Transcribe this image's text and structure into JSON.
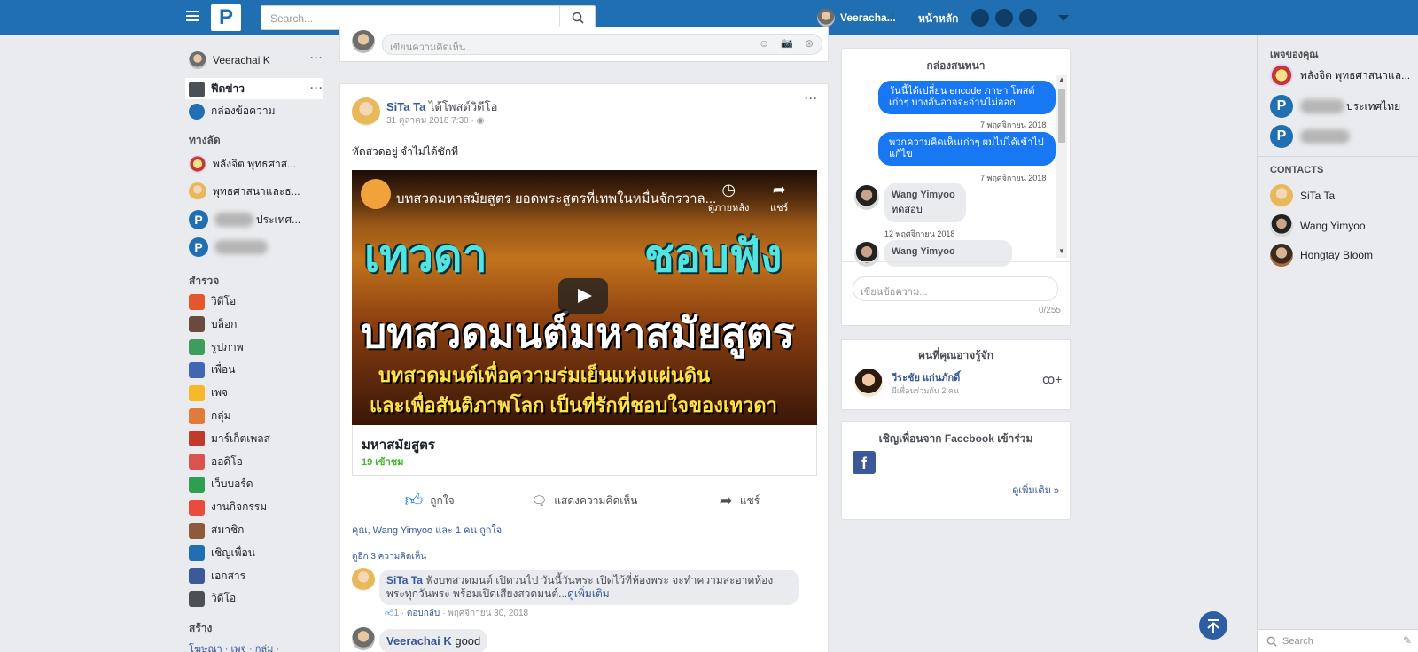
{
  "header": {
    "search_placeholder": "Search...",
    "user_name": "Veeracha...",
    "home_label": "หน้าหลัก"
  },
  "left_sidebar": {
    "profile_name": "Veerachai K",
    "news_feed": "ฟีดข่าว",
    "inbox": "กล่องข้อความ",
    "shortcuts_title": "ทางลัด",
    "shortcuts": [
      "พลังจิต พุทธศาส...",
      "พุทธศาสนาและธ...",
      "ประเทศ..."
    ],
    "explore_title": "สำรวจ",
    "explore": [
      {
        "label": "วิดีโอ",
        "icon": "video-clapper-icon",
        "color": "#e4572e"
      },
      {
        "label": "บล็อก",
        "icon": "blog-icon",
        "color": "#6a4a3c"
      },
      {
        "label": "รูปภาพ",
        "icon": "photo-icon",
        "color": "#3c9d5d"
      },
      {
        "label": "เพื่อน",
        "icon": "friends-icon",
        "color": "#4267b2"
      },
      {
        "label": "เพจ",
        "icon": "page-flag-icon",
        "color": "#f7b928"
      },
      {
        "label": "กลุ่ม",
        "icon": "group-icon",
        "color": "#e07b39"
      },
      {
        "label": "มาร์เก็ตเพลส",
        "icon": "marketplace-icon",
        "color": "#c0392b"
      },
      {
        "label": "ออดิโอ",
        "icon": "headphones-icon",
        "color": "#d9534f"
      },
      {
        "label": "เว็บบอร์ด",
        "icon": "forum-icon",
        "color": "#2e9e4f"
      },
      {
        "label": "งานกิจกรรม",
        "icon": "event-calendar-icon",
        "color": "#e74c3c"
      },
      {
        "label": "สมาชิก",
        "icon": "members-icon",
        "color": "#8e5a3c"
      },
      {
        "label": "เชิญเพื่อน",
        "icon": "invite-icon",
        "color": "#1f6fb2"
      },
      {
        "label": "เอกสาร",
        "icon": "document-icon",
        "color": "#3b5998"
      },
      {
        "label": "วิดีโอ",
        "icon": "video-camera-icon",
        "color": "#4b4f56"
      }
    ],
    "create_title": "สร้าง",
    "create_links": "โฆษณา · เพจ · กลุ่ม ·"
  },
  "feed": {
    "comment_placeholder_top": "เขียนความคิดเห็น...",
    "post": {
      "author": "SiTa Ta",
      "action": "ได้โพสต์วิดีโอ",
      "time": "31 ตุลาคม 2018 7:30",
      "text": "หัดสวดอยู่ จำไม่ได้ซักที",
      "video": {
        "title": "บทสวดมหาสมัยสูตร ยอดพระสูตรที่เทพในหมื่นจักรวาล...",
        "watch_later": "ดูภายหลัง",
        "share": "แชร์",
        "line1_left": "เทวดา",
        "line1_right": "ชอบฟัง",
        "line2": "บทสวดมนต์มหาสมัยสูตร",
        "line3": "บทสวดมนต์เพื่อความร่มเย็นแห่งแผ่นดิน",
        "line4": "และเพื่อสันติภาพโลก เป็นที่รักที่ชอบใจของเทวดา"
      },
      "video_caption": "มหาสมัยสูตร",
      "views": "19 เข้าชม",
      "like": "ถูกใจ",
      "comment": "แสดงความคิดเห็น",
      "share": "แชร์",
      "likes_summary": "คุณ, Wang Yimyoo และ 1 คน ถูกใจ",
      "view_comments": "ดูอีก 3 ความคิดเห็น",
      "comments": [
        {
          "author": "SiTa Ta",
          "text": "ฟังบทสวดมนต์ เปิดวนไป วันนี้วันพระ เปิดไว้ที่ห้องพระ จะทำความสะอาดห้อง พระทุกวันพระ พร้อมเปิดเสียงสวดมนต์...",
          "more": "ดูเพิ่มเติม",
          "likes": "1",
          "reply": "ตอบกลับ",
          "date": "พฤศจิกายน 30, 2018"
        },
        {
          "author": "Veerachai K",
          "text": "good"
        }
      ]
    }
  },
  "chat": {
    "title": "กล่องสนทนา",
    "messages": [
      {
        "text": "วันนี้ได้เปลี่ยน encode ภาษา โพสต์เก่าๆ บางอันอาจจะอ่านไม่ออก",
        "time": "7 พฤศจิกายน 2018"
      },
      {
        "text": "พวกความคิดเห็นเก่าๆ ผมไม่ได้เข้าไปแก้ไข",
        "time": "7 พฤศจิกายน 2018"
      },
      {
        "author": "Wang Yimyoo",
        "text": "ทดสอบ",
        "time": "12 พฤศจิกายน 2018"
      },
      {
        "author": "Wang Yimyoo",
        "text": ""
      }
    ],
    "input_placeholder": "เขียนข้อความ...",
    "counter": "0/255"
  },
  "suggest": {
    "title": "คนที่คุณอาจรู้จัก",
    "name": "วีระชัย แก่นภักดิ์",
    "mutual": "มีเพื่อนร่วมกัน 2 คน"
  },
  "invite": {
    "title": "เชิญเพื่อนจาก Facebook เข้าร่วม",
    "more": "ดูเพิ่มเติม »"
  },
  "right_sidebar": {
    "pages_title": "เพจของคุณ",
    "pages": [
      "พลังจิต พุทธศาสนาแล...",
      "ประเทศไทย"
    ],
    "contacts_title": "CONTACTS",
    "contacts": [
      "SiTa Ta",
      "Wang Yimyoo",
      "Hongtay Bloom"
    ],
    "search_placeholder": "Search"
  }
}
